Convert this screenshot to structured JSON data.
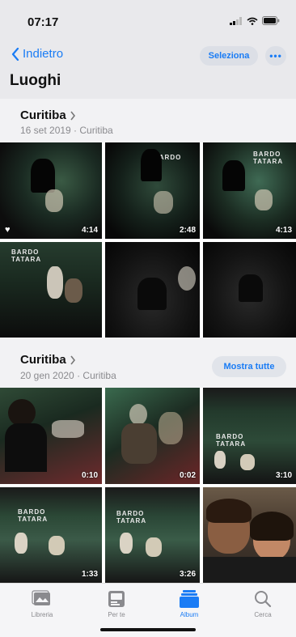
{
  "status_bar": {
    "time": "07:17"
  },
  "nav": {
    "back_label": "Indietro",
    "select_label": "Seleziona",
    "more_label": "•••",
    "title": "Luoghi"
  },
  "sections": [
    {
      "title": "Curitiba",
      "subtitle": "16 set 2019 · Curitiba"
    },
    {
      "title": "Curitiba",
      "subtitle": "20 gen 2020 · Curitiba",
      "action_label": "Mostra tutte"
    }
  ],
  "thumbnails_sec1": [
    {
      "duration": "4:14",
      "favorite": true
    },
    {
      "duration": "2:48"
    },
    {
      "duration": "4:13"
    },
    {
      "duration": ""
    },
    {
      "duration": ""
    },
    {
      "duration": ""
    }
  ],
  "thumbnails_sec2": [
    {
      "duration": "0:10"
    },
    {
      "duration": "0:02"
    },
    {
      "duration": "3:10"
    },
    {
      "duration": "1:33"
    },
    {
      "duration": "3:26"
    },
    {
      "duration": ""
    }
  ],
  "signs": {
    "line1": "BARDO",
    "line2": "TATARA"
  },
  "tabs": [
    {
      "label": "Libreria",
      "icon": "photos-library-icon"
    },
    {
      "label": "Per te",
      "icon": "for-you-icon"
    },
    {
      "label": "Album",
      "icon": "album-icon",
      "active": true
    },
    {
      "label": "Cerca",
      "icon": "search-icon"
    }
  ],
  "colors": {
    "accent": "#1a7cf5",
    "background": "#f2f2f4"
  }
}
